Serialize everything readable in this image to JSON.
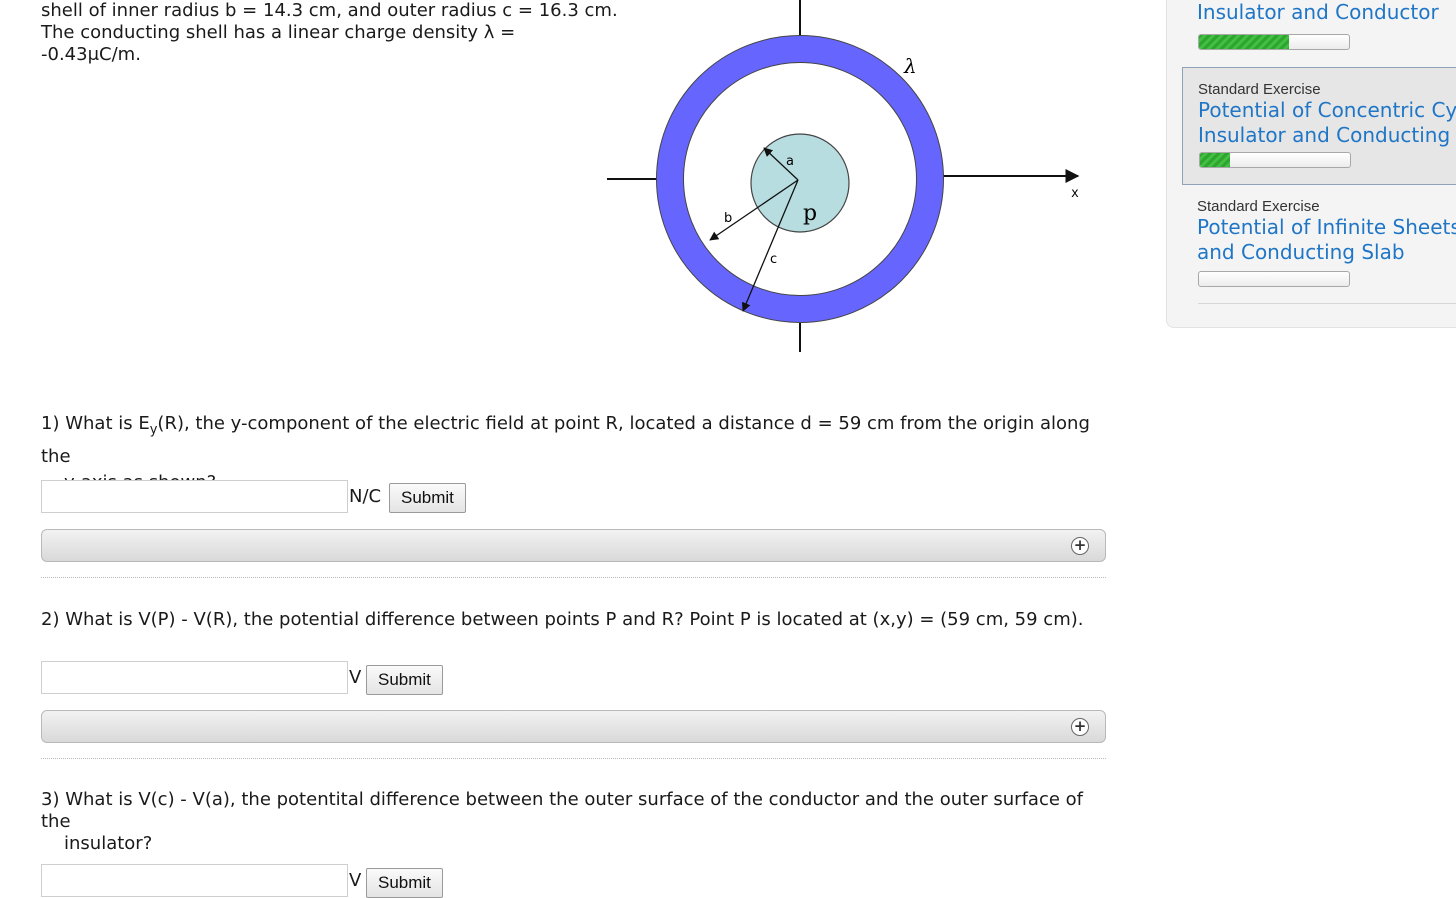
{
  "problem": {
    "lines": [
      "shell of inner radius b = 14.3 cm, and outer radius c = 16.3 cm.",
      "The conducting shell has a linear charge density λ =",
      "-0.43μC/m."
    ]
  },
  "diagram": {
    "label_lambda": "λ",
    "label_a": "a",
    "label_b": "b",
    "label_c": "c",
    "label_p": "p",
    "label_x": "x",
    "shell_color": "#6666ff",
    "insulator_color": "#b8dde0"
  },
  "questions": [
    {
      "number": "1)",
      "text_pre": "What is E",
      "sub": "y",
      "text_post": "(R), the y-component of the electric field at point R, located a distance d = 59 cm from the origin along the",
      "continuation": "y-axis as shown?",
      "unit": "N/C",
      "submit": "Submit",
      "value": ""
    },
    {
      "number": "2)",
      "text": "What is V(P) - V(R), the potential difference between points P and R? Point P is located at (x,y) = (59 cm, 59 cm).",
      "unit": "V",
      "submit": "Submit",
      "value": ""
    },
    {
      "number": "3)",
      "text": "What is V(c) - V(a), the potentital difference between the outer surface of the conductor and the outer surface of the",
      "continuation": "insulator?",
      "unit": "V",
      "submit": "Submit",
      "value": ""
    }
  ],
  "sidebar": {
    "items": [
      {
        "type": "",
        "title_lines": [
          "Insulator and Conductor"
        ],
        "progress": 0.6
      },
      {
        "type": "Standard Exercise",
        "title_lines": [
          "Potential of Concentric Cy",
          "Insulator and Conducting S"
        ],
        "progress": 0.2
      },
      {
        "type": "Standard Exercise",
        "title_lines": [
          "Potential of Infinite Sheets",
          "and Conducting Slab"
        ],
        "progress": 0.0
      }
    ],
    "progress_color": "#2ea52e",
    "link_color": "#1f76c6"
  }
}
